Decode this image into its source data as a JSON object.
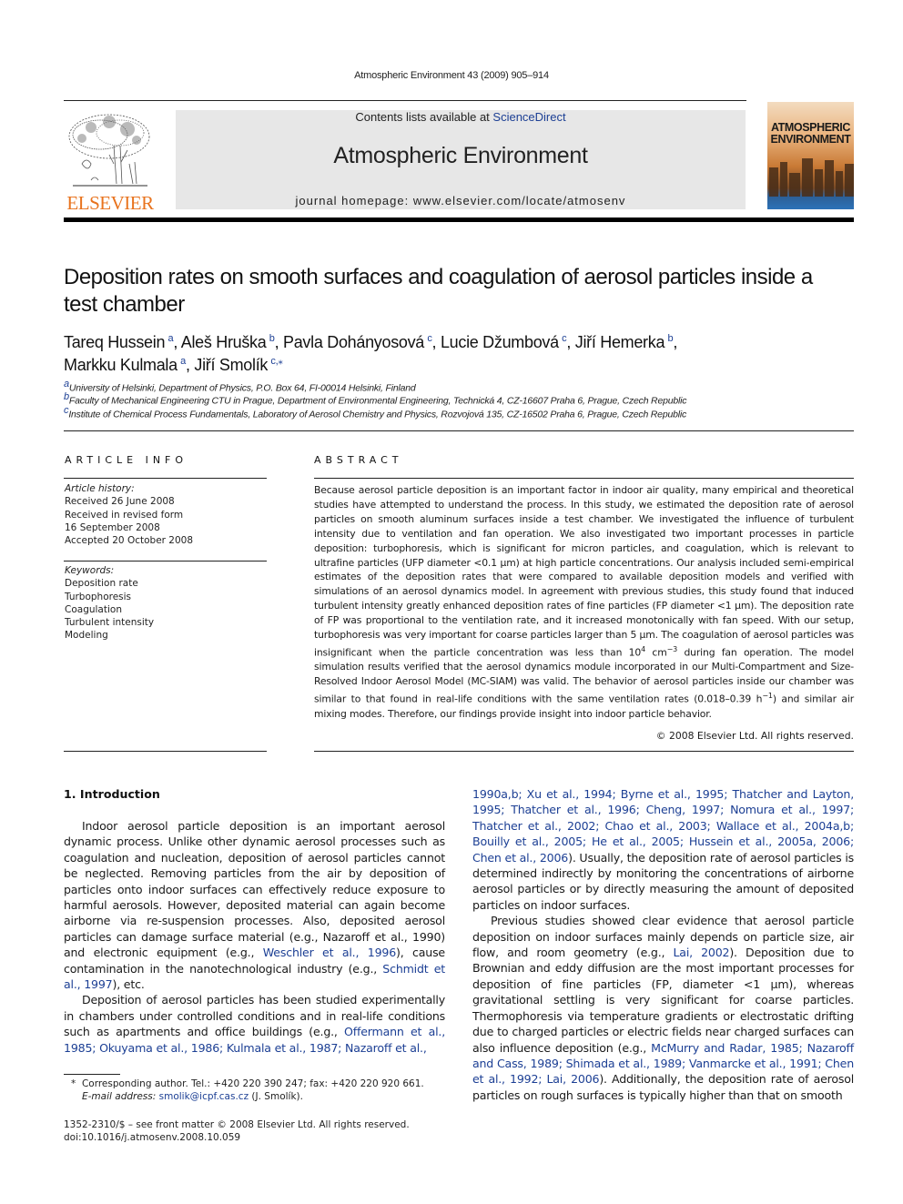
{
  "header": {
    "running_head": "Atmospheric Environment 43 (2009) 905–914",
    "publisher_logo_text": "ELSEVIER",
    "contents_prefix": "Contents lists available at ",
    "contents_link": "ScienceDirect",
    "journal_title": "Atmospheric Environment",
    "homepage": "journal homepage: www.elsevier.com/locate/atmosenv",
    "cover_title_line1": "ATMOSPHERIC",
    "cover_title_line2": "ENVIRONMENT",
    "colors": {
      "elsevier_orange": "#e8731e",
      "link_blue": "#1c3f94",
      "masthead_gray": "#e7e7e7"
    }
  },
  "article": {
    "title": "Deposition rates on smooth surfaces and coagulation of aerosol particles inside a test chamber",
    "authors": [
      {
        "name": "Tareq Hussein",
        "aff": "a"
      },
      {
        "name": "Aleš Hruška",
        "aff": "b"
      },
      {
        "name": "Pavla Dohányosová",
        "aff": "c"
      },
      {
        "name": "Lucie Džumbová",
        "aff": "c"
      },
      {
        "name": "Jiří Hemerka",
        "aff": "b"
      },
      {
        "name": "Markku Kulmala",
        "aff": "a"
      },
      {
        "name": "Jiří Smolík",
        "aff": "c,⁎"
      }
    ],
    "affiliations": [
      {
        "key": "a",
        "text": "University of Helsinki, Department of Physics, P.O. Box 64, FI-00014 Helsinki, Finland"
      },
      {
        "key": "b",
        "text": "Faculty of Mechanical Engineering CTU in Prague, Department of Environmental Engineering, Technická 4, CZ-16607 Praha 6, Prague, Czech Republic"
      },
      {
        "key": "c",
        "text": "Institute of Chemical Process Fundamentals, Laboratory of Aerosol Chemistry and Physics, Rozvojová 135, CZ-16502 Praha 6, Prague, Czech Republic"
      }
    ]
  },
  "article_info": {
    "heading": "ARTICLE INFO",
    "history_label": "Article history:",
    "history": [
      "Received 26 June 2008",
      "Received in revised form",
      "16 September 2008",
      "Accepted 20 October 2008"
    ],
    "keywords_label": "Keywords:",
    "keywords": [
      "Deposition rate",
      "Turbophoresis",
      "Coagulation",
      "Turbulent intensity",
      "Modeling"
    ]
  },
  "abstract": {
    "heading": "ABSTRACT",
    "part1": "Because aerosol particle deposition is an important factor in indoor air quality, many empirical and theoretical studies have attempted to understand the process. In this study, we estimated the deposition rate of aerosol particles on smooth aluminum surfaces inside a test chamber. We investigated the influence of turbulent intensity due to ventilation and fan operation. We also investigated two important processes in particle deposition: turbophoresis, which is significant for micron particles, and coagulation, which is relevant to ultrafine particles (UFP diameter <0.1 μm) at high particle concentrations. Our analysis included semi-empirical estimates of the deposition rates that were compared to available deposition models and verified with simulations of an aerosol dynamics model. In agreement with previous studies, this study found that induced turbulent intensity greatly enhanced deposition rates of fine particles (FP diameter <1 μm). The deposition rate of FP was proportional to the ventilation rate, and it increased monotonically with fan speed. With our setup, turbophoresis was very important for coarse particles larger than 5 μm. The coagulation of aerosol particles was insignificant when the particle concentration was less than 10",
    "sup1": "4",
    "part2": " cm",
    "sup2": "−3",
    "part3": " during fan operation. The model simulation results verified that the aerosol dynamics module incorporated in our Multi-Compartment and Size-Resolved Indoor Aerosol Model (MC-SIAM) was valid. The behavior of aerosol particles inside our chamber was similar to that found in real-life conditions with the same ventilation rates (0.018–0.39 h",
    "sup3": "−1",
    "part4": ") and similar air mixing modes. Therefore, our findings provide insight into indoor particle behavior.",
    "copyright": "© 2008 Elsevier Ltd. All rights reserved."
  },
  "introduction": {
    "heading": "1.  Introduction",
    "left_p1_a": "Indoor aerosol particle deposition is an important aerosol dynamic process. Unlike other dynamic aerosol processes such as coagulation and nucleation, deposition of aerosol particles cannot be neglected. Removing particles from the air by deposition of particles onto indoor surfaces can effectively reduce exposure to harmful aerosols. However, deposited material can again become airborne via re-suspension processes. Also, deposited aerosol particles can damage surface material (e.g., Nazaroff et al., 1990) and electronic equipment (e.g., ",
    "left_p1_cite1": "Weschler et al., 1996",
    "left_p1_b": "), cause contamination in the nanotechnological industry (e.g., ",
    "left_p1_cite2": "Schmidt et al., 1997",
    "left_p1_c": "), etc.",
    "left_p2_a": "Deposition of aerosol particles has been studied experimentally in chambers under controlled conditions and in real-life conditions such as apartments and office buildings (e.g., ",
    "left_p2_cite": "Offermann et al., 1985; Okuyama et al., 1986; Kulmala et al., 1987; Nazaroff et al.,",
    "right_p1_cite": "1990a,b; Xu et al., 1994; Byrne et al., 1995; Thatcher and Layton, 1995; Thatcher et al., 1996; Cheng, 1997; Nomura et al., 1997; Thatcher et al., 2002; Chao et al., 2003; Wallace et al., 2004a,b; Bouilly et al., 2005; He et al., 2005; Hussein et al., 2005a, 2006; Chen et al., 2006",
    "right_p1_b": "). Usually, the deposition rate of aerosol particles is determined indirectly by monitoring the concentrations of airborne aerosol particles or by directly measuring the amount of deposited particles on indoor surfaces.",
    "right_p2_a": "Previous studies showed clear evidence that aerosol particle deposition on indoor surfaces mainly depends on particle size, air flow, and room geometry (e.g., ",
    "right_p2_cite1": "Lai, 2002",
    "right_p2_b": "). Deposition due to Brownian and eddy diffusion are the most important processes for deposition of fine particles (FP, diameter <1 μm), whereas gravitational settling is very significant for coarse particles. Thermophoresis via temperature gradients or electrostatic drifting due to charged particles or electric fields near charged surfaces can also influence deposition (e.g., ",
    "right_p2_cite2": "McMurry and Radar, 1985; Nazaroff and Cass, 1989; Shimada et al., 1989; Vanmarcke et al., 1991; Chen et al., 1992; Lai, 2006",
    "right_p2_c": "). Additionally, the deposition rate of aerosol particles on rough surfaces is typically higher than that on smooth"
  },
  "footnote": {
    "star": "*",
    "corresponding": "Corresponding author. Tel.: +420 220 390 247; fax: +420 220 920 661.",
    "email_label": "E-mail address: ",
    "email": "smolik@icpf.cas.cz",
    "email_suffix": " (J. Smolík)."
  },
  "front_matter": {
    "issn": "1352-2310/$ – see front matter © 2008 Elsevier Ltd. All rights reserved.",
    "doi": "doi:10.1016/j.atmosenv.2008.10.059"
  }
}
